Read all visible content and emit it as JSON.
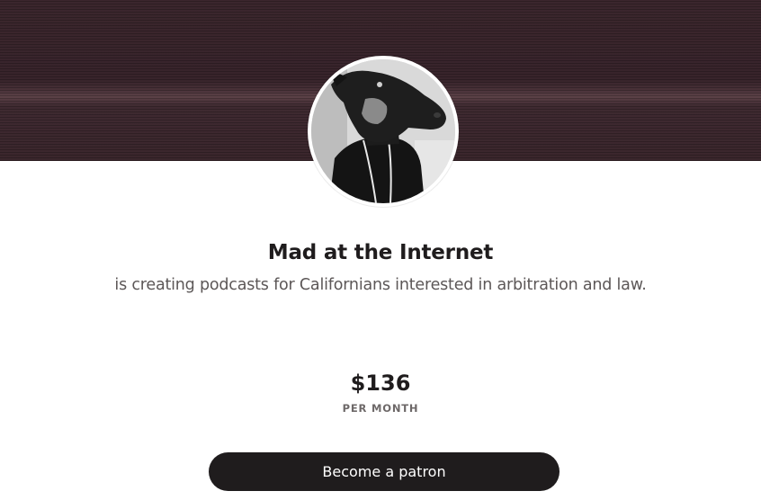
{
  "creator": {
    "name": "Mad at the Internet",
    "tagline": "is creating podcasts for Californians interested in arbitration and law."
  },
  "earnings": {
    "amount": "$136",
    "period": "PER MONTH"
  },
  "actions": {
    "become_patron_label": "Become a patron"
  },
  "colors": {
    "banner": "#3a262c",
    "button_bg": "#1f1c1d",
    "title_text": "#1f1c1d",
    "subtitle_text": "#5c5757"
  },
  "icons": {
    "avatar": "creator-avatar-image"
  }
}
